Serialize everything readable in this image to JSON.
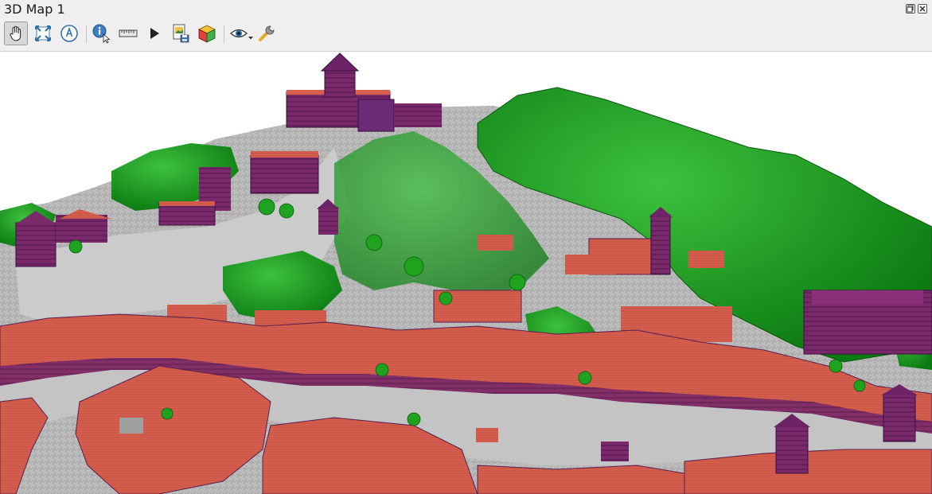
{
  "window": {
    "title": "3D Map 1",
    "controls": [
      "restore-icon",
      "close-icon"
    ]
  },
  "toolbar": {
    "buttons": [
      {
        "name": "pan-tool",
        "icon": "hand-icon",
        "active": true
      },
      {
        "name": "zoom-full",
        "icon": "zoom-full-icon",
        "active": false
      },
      {
        "name": "camera-north",
        "icon": "compass-icon",
        "active": false
      },
      {
        "name": "identify",
        "icon": "identify-icon",
        "active": false
      },
      {
        "name": "measure-line",
        "icon": "ruler-icon",
        "active": false
      },
      {
        "name": "animation",
        "icon": "play-icon",
        "active": false
      },
      {
        "name": "save-image",
        "icon": "save-image-icon",
        "active": false
      },
      {
        "name": "export-3d-scene",
        "icon": "cube-icon",
        "active": false
      },
      {
        "name": "view-options",
        "icon": "eye-icon",
        "active": false
      },
      {
        "name": "configure",
        "icon": "wrench-icon",
        "active": false
      }
    ]
  },
  "scene": {
    "description_colors": {
      "sky": "#ffffff",
      "terrain": "#b9b9b9",
      "trees": "#1fa31f",
      "buildings_light": "#e8705c",
      "buildings_dark": "#5a1f6e"
    }
  }
}
